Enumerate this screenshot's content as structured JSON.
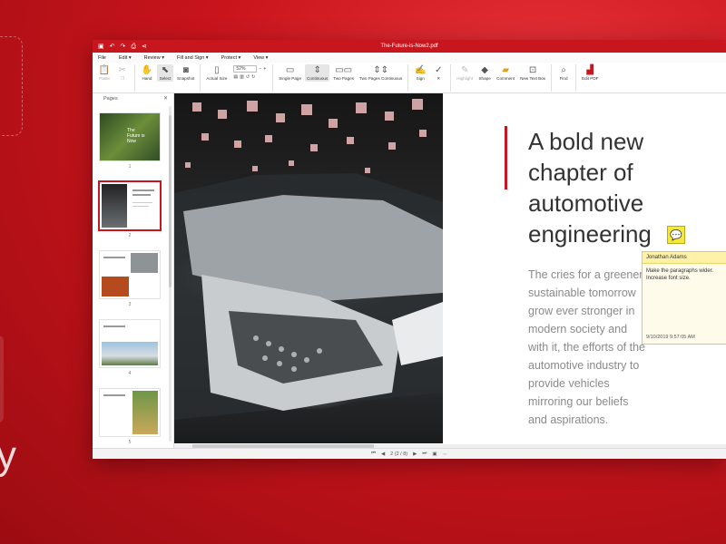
{
  "window": {
    "title": "The-Future-is-Now2.pdf",
    "quick_access": [
      "save-icon",
      "undo-icon",
      "redo-icon",
      "print-icon",
      "share-icon"
    ]
  },
  "menu": [
    {
      "label": "File"
    },
    {
      "label": "Edit"
    },
    {
      "label": "Review"
    },
    {
      "label": "Fill and Sign"
    },
    {
      "label": "Protect"
    },
    {
      "label": "View"
    }
  ],
  "ribbon": {
    "paste": "Paste",
    "hand": "Hand",
    "select": "Select",
    "snapshot": "Snapshot",
    "actual_size": "Actual Size",
    "zoom_value": "52%",
    "single_page": "Single Page",
    "continuous": "Continuous",
    "two_pages": "Two Pages",
    "two_pages_continuous": "Two Pages Continuous",
    "sign": "Sign",
    "highlight": "Highlight",
    "shape": "Shape",
    "comment": "Comment",
    "new_text_box": "New Text Box",
    "find": "Find",
    "edit_pdf": "Edit PDF"
  },
  "pages_panel": {
    "title": "Pages",
    "pages": [
      {
        "num": "1",
        "title": "The Future is Now"
      },
      {
        "num": "2"
      },
      {
        "num": "3"
      },
      {
        "num": "4"
      },
      {
        "num": "5"
      }
    ]
  },
  "document": {
    "heading": "A bold new chapter of automotive engineering",
    "paragraph": "The cries for a greener, sustainable tomorrow grow ever stronger in modern society and with it, the efforts of the automotive industry to provide vehicles mirroring our beliefs and aspirations."
  },
  "comment": {
    "author": "Jonathan Adams",
    "text": "Make the paragraphs wider. Increase font size.",
    "time": "9/10/2019 9:57:05 AM"
  },
  "status": {
    "page_indicator": "2 (2 / 8)"
  },
  "colors": {
    "brand_red": "#c7161d",
    "note_yellow": "#f4e83a"
  }
}
